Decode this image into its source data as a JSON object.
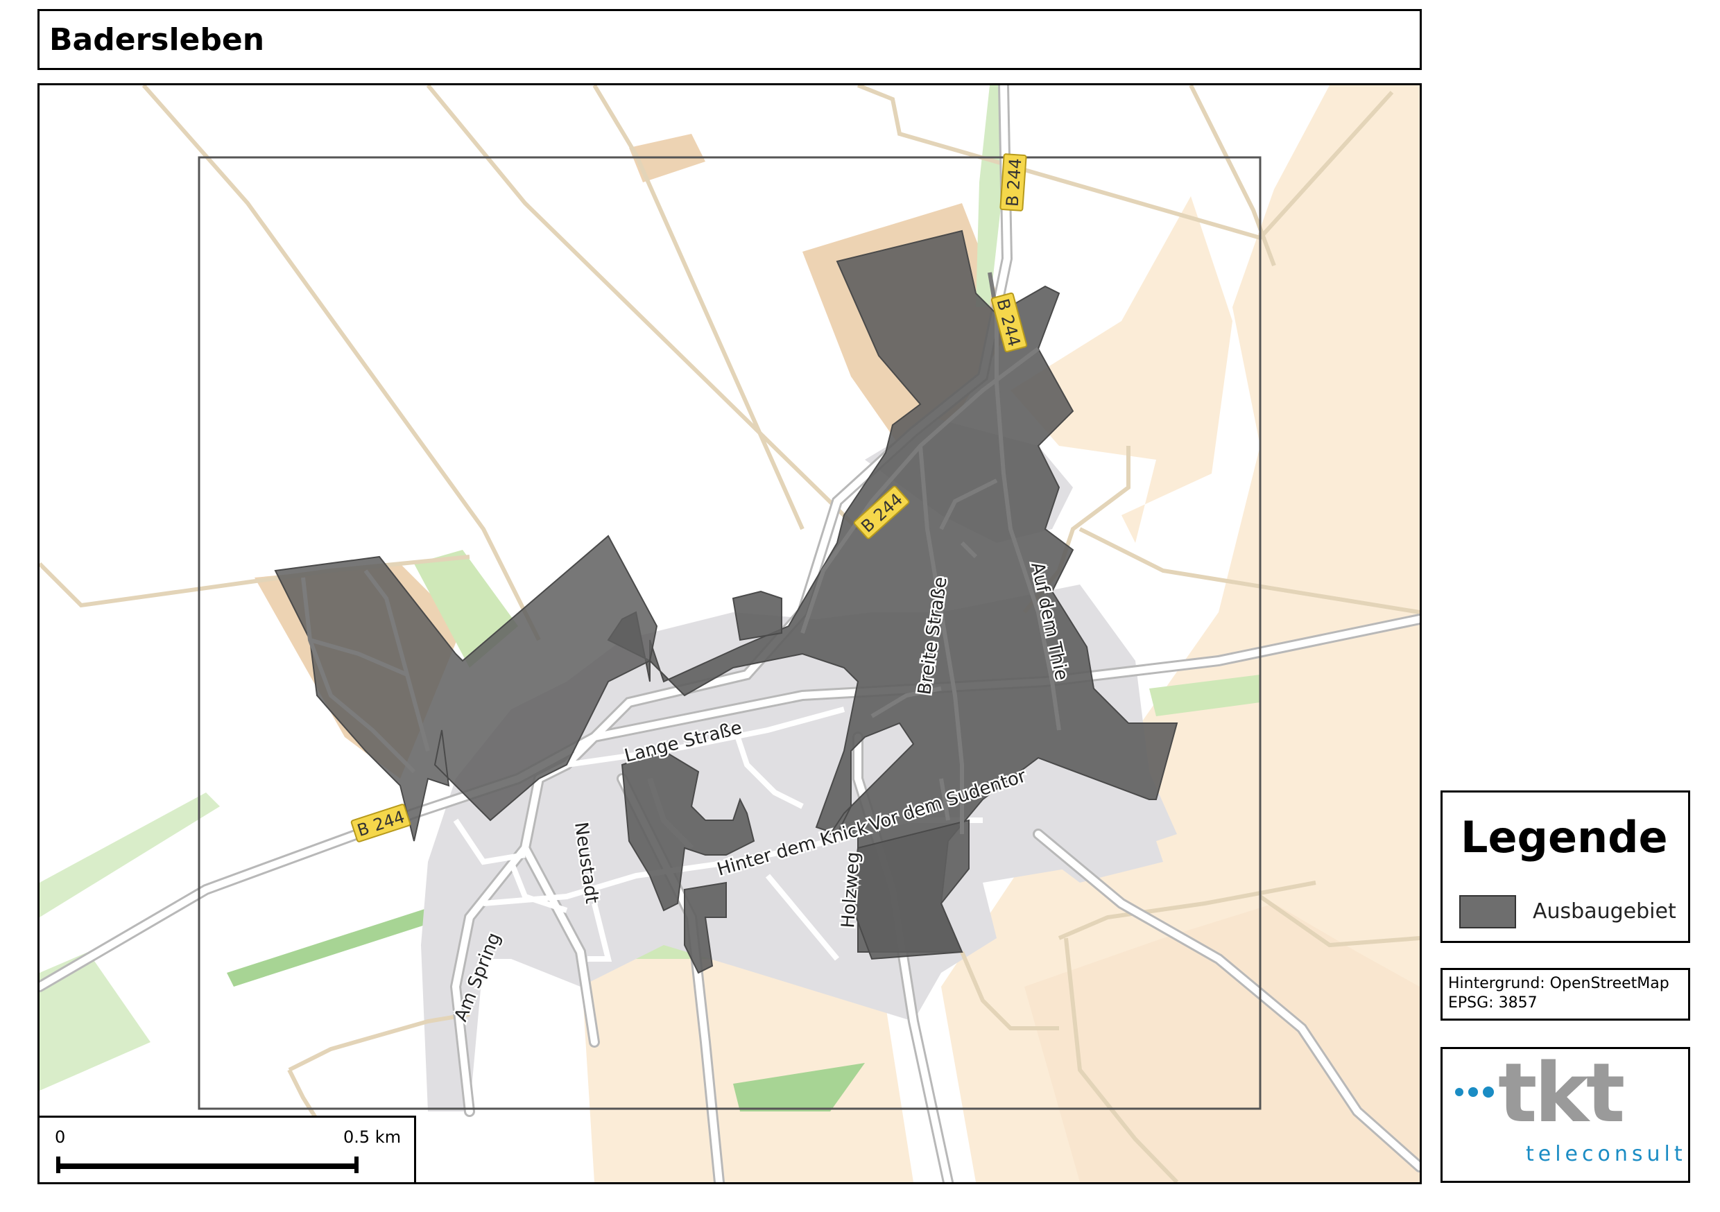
{
  "map": {
    "title": "Badersleben",
    "street_labels": {
      "b244_1": "B 244",
      "b244_2": "B 244",
      "b244_3": "B 244",
      "b244_4": "B 244",
      "breite_strasse": "Breite Straße",
      "auf_dem_thie": "Auf dem Thie",
      "lange_strasse": "Lange Straße",
      "neustadt": "Neustadt",
      "hinter_dem_knick": "Hinter dem Knick",
      "vor_dem_sudentor": "Vor dem Sudentor",
      "holzweg": "Holzweg",
      "am_spring": "Am Spring"
    },
    "colors": {
      "ausbaugebiet": "#5f5f5f",
      "farmland": "#fbecd7",
      "forest": "#c8e6b0",
      "residential": "#e0dfe2",
      "road": "#ffffff",
      "track": "#e8d9bd"
    }
  },
  "scale": {
    "zero": "0",
    "end": "0.5 km"
  },
  "legend": {
    "title": "Legende",
    "item_label": "Ausbaugebiet"
  },
  "source": {
    "line1": "Hintergrund: OpenStreetMap",
    "line2": "EPSG: 3857"
  },
  "logo": {
    "name": "tkt",
    "sub": "teleconsult"
  }
}
